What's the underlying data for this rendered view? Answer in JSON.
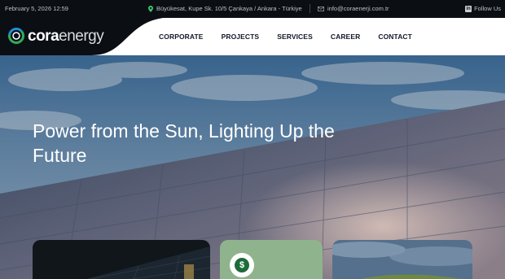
{
  "topbar": {
    "date": "February 5, 2026 12:59",
    "address": "Büyükesat, Kupe Sk. 10/5 Çankaya / Ankara - Türkiye",
    "email": "info@coraenerji.com.tr",
    "follow": "Follow Us"
  },
  "brand": {
    "name_bold": "cora",
    "name_light": "energy"
  },
  "nav": [
    {
      "label": "CORPORATE"
    },
    {
      "label": "PROJECTS"
    },
    {
      "label": "SERVICES"
    },
    {
      "label": "CAREER"
    },
    {
      "label": "CONTACT"
    }
  ],
  "hero": {
    "title": "Power from the Sun, Lighting Up the Future"
  },
  "cards": [
    {
      "name": "solar-panel-card",
      "icon": ""
    },
    {
      "name": "finance-card",
      "icon": "$"
    },
    {
      "name": "landscape-card",
      "icon": ""
    }
  ],
  "colors": {
    "topbar_bg": "#0b0f14",
    "header_bg": "#ffffff",
    "logo_bg": "#0b0f14",
    "accent_green": "#8fb48d"
  }
}
